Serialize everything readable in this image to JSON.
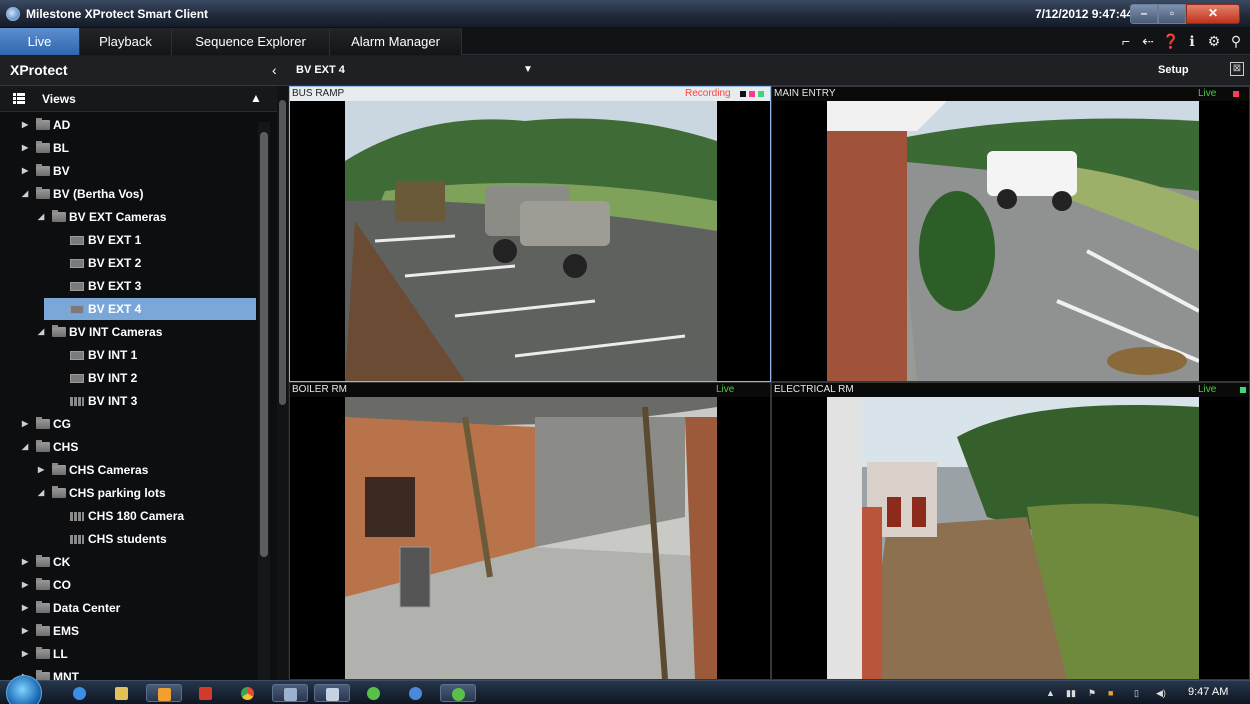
{
  "window": {
    "title": "Milestone XProtect Smart Client",
    "datetime": "7/12/2012 9:47:44 AM"
  },
  "tabs": [
    {
      "label": "Live",
      "active": true
    },
    {
      "label": "Playback",
      "active": false
    },
    {
      "label": "Sequence Explorer",
      "active": false
    },
    {
      "label": "Alarm Manager",
      "active": false
    }
  ],
  "sidebar": {
    "title": "XProtect",
    "views_label": "Views",
    "tree": [
      {
        "label": "AD"
      },
      {
        "label": "BL"
      },
      {
        "label": "BV"
      },
      {
        "label": "BV (Bertha Vos)"
      },
      {
        "label": "BV EXT Cameras"
      },
      {
        "label": "BV EXT 1"
      },
      {
        "label": "BV EXT 2"
      },
      {
        "label": "BV EXT 3"
      },
      {
        "label": "BV EXT 4"
      },
      {
        "label": "BV INT Cameras"
      },
      {
        "label": "BV INT 1"
      },
      {
        "label": "BV INT 2"
      },
      {
        "label": "BV INT 3"
      },
      {
        "label": "CG"
      },
      {
        "label": "CHS"
      },
      {
        "label": "CHS Cameras"
      },
      {
        "label": "CHS parking lots"
      },
      {
        "label": "CHS 180 Camera"
      },
      {
        "label": "CHS students"
      },
      {
        "label": "CK"
      },
      {
        "label": "CO"
      },
      {
        "label": "Data Center"
      },
      {
        "label": "EMS"
      },
      {
        "label": "LL"
      },
      {
        "label": "MNT"
      }
    ]
  },
  "view": {
    "name": "BV EXT 4",
    "setup_label": "Setup"
  },
  "cameras": [
    {
      "name": "BUS RAMP",
      "status": "Recording",
      "status_color": "#ff4040"
    },
    {
      "name": "MAIN ENTRY",
      "status": "Live",
      "status_color": "#46d146"
    },
    {
      "name": "BOILER RM",
      "status": "Live",
      "status_color": "#46d146"
    },
    {
      "name": "ELECTRICAL RM",
      "status": "Live",
      "status_color": "#46d146"
    }
  ],
  "taskbar": {
    "time": "9:47 AM"
  },
  "colors": {
    "accent": "#3f78c0",
    "selected": "#7aa7d8",
    "recording": "#ff4040",
    "live": "#46d146"
  },
  "icons": [
    "windows-start-icon",
    "internet-explorer-icon",
    "file-explorer-icon",
    "outlook-icon",
    "chrome-icon"
  ]
}
